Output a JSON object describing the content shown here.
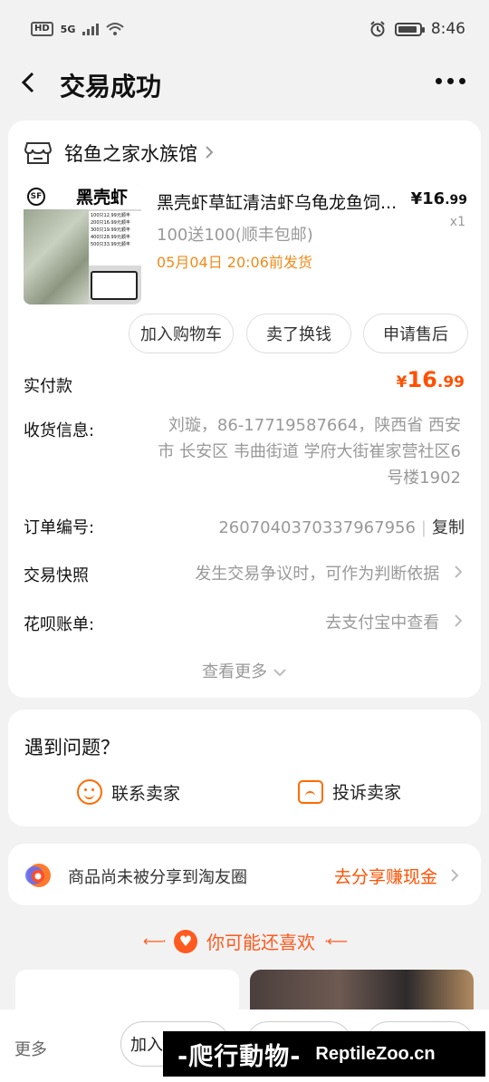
{
  "status_bar": {
    "network_hd": "HD",
    "network_5g": "5G",
    "time": "8:46",
    "battery_level": 0.9
  },
  "nav": {
    "title": "交易成功"
  },
  "order": {
    "shop_name": "铭鱼之家水族馆",
    "product": {
      "thumbnail_text": "黑壳虾",
      "thumbnail_badge": "SF",
      "thumbnail_price_list": [
        "100只12.99元顺丰",
        "200只16.99元顺丰",
        "300只19.99元顺丰",
        "400只28.99元顺丰",
        "500只33.99元顺丰"
      ],
      "title": "黑壳虾草缸清洁虾乌龟龙鱼饲...",
      "sku": "100送100(顺丰包邮)",
      "ship_time": "05月04日 20:06前发货",
      "price_symbol": "¥",
      "price_int": "16",
      "price_dec": ".99",
      "quantity": "x1"
    },
    "actions": [
      "加入购物车",
      "卖了换钱",
      "申请售后"
    ],
    "paid_label": "实付款",
    "paid_symbol": "¥",
    "paid_int": "16",
    "paid_dec": ".99",
    "shipping_label": "收货信息:",
    "shipping_value": "刘璇，86-17719587664，陕西省 西安市 长安区 韦曲街道 学府大街崔家营社区6号楼1902",
    "order_no_label": "订单编号:",
    "order_no": "2607040370337967956",
    "copy_label": "复制",
    "snapshot_label": "交易快照",
    "snapshot_value": "发生交易争议时，可作为判断依据",
    "huabei_label": "花呗账单:",
    "huabei_value": "去支付宝中查看",
    "see_more": "查看更多"
  },
  "help": {
    "title": "遇到问题？",
    "contact": "联系卖家",
    "complain": "投诉卖家"
  },
  "share": {
    "text": "商品尚未被分享到淘友圈",
    "cta": "去分享赚现金"
  },
  "recommend": {
    "title": "你可能还喜欢"
  },
  "bottom": {
    "more": "更多",
    "button_1": "加入"
  },
  "watermark": {
    "cn": "-爬行動物-",
    "en": "ReptileZoo.cn"
  },
  "colors": {
    "accent": "#ff5000",
    "ship_orange": "#f08b1a",
    "background": "#f2f2f2"
  }
}
